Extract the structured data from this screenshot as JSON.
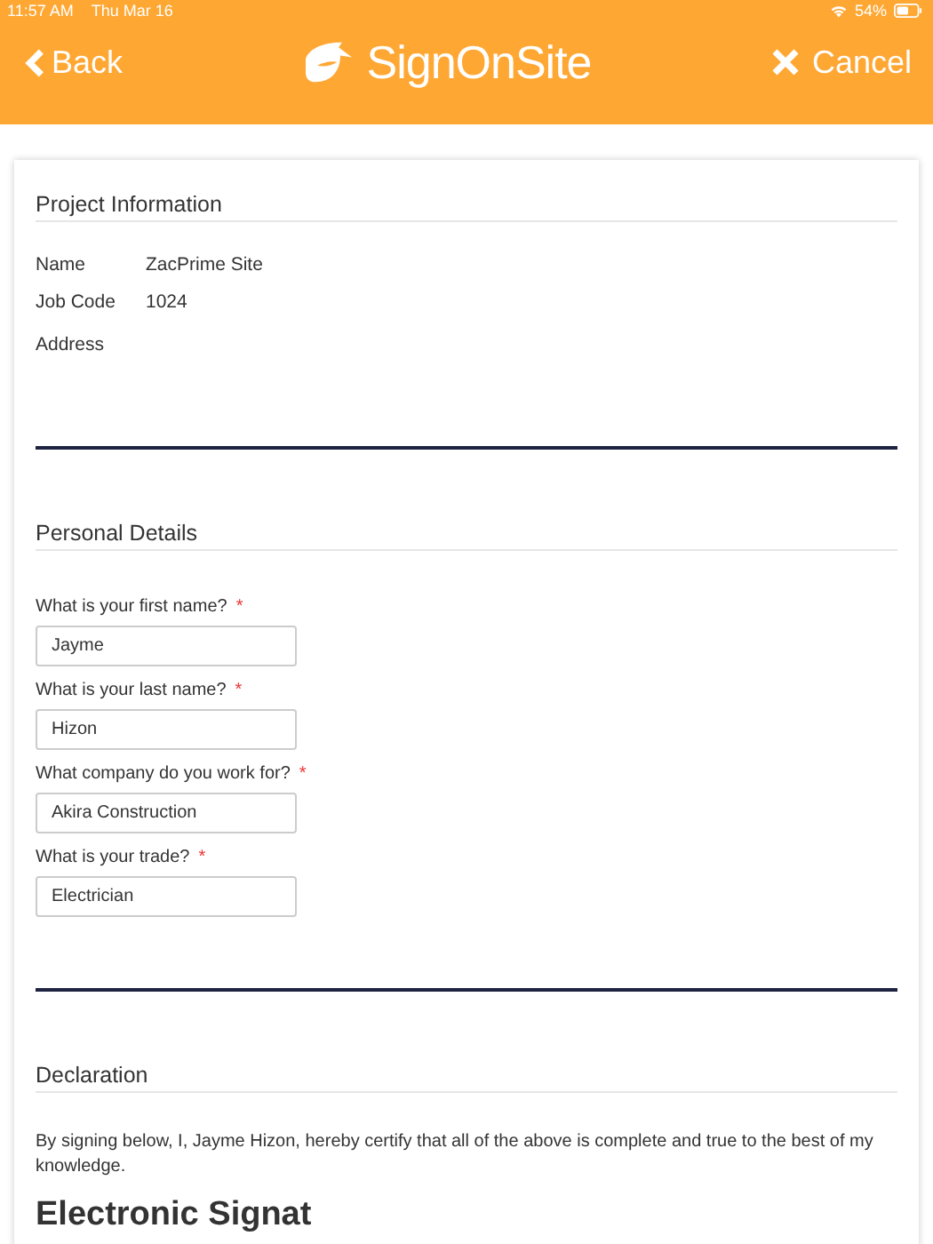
{
  "status_bar": {
    "time": "11:57 AM",
    "date": "Thu Mar 16",
    "battery": "54%"
  },
  "nav": {
    "back": "Back",
    "title": "SignOnSite",
    "cancel": "Cancel"
  },
  "project": {
    "heading": "Project Information",
    "fields": [
      {
        "label": "Name",
        "value": "ZacPrime Site"
      },
      {
        "label": "Job Code",
        "value": "1024"
      },
      {
        "label": "Address"
      }
    ]
  },
  "personal": {
    "heading": "Personal Details",
    "questions": [
      {
        "label": "What is your first name?",
        "required_mark": "*",
        "value": "Jayme"
      },
      {
        "label": "What is your last name?",
        "required_mark": "*",
        "value": "Hizon"
      },
      {
        "label": "What company do you work for?",
        "required_mark": "*",
        "value": "Akira Construction"
      },
      {
        "label": "What is your trade?",
        "required_mark": "*",
        "value": "Electrician"
      }
    ]
  },
  "declaration": {
    "heading": "Declaration",
    "text": "By signing below, I, Jayme Hizon, hereby certify that all of the above is complete and true to the best of my knowledge."
  },
  "signature": {
    "heading": "Electronic Signat"
  }
}
